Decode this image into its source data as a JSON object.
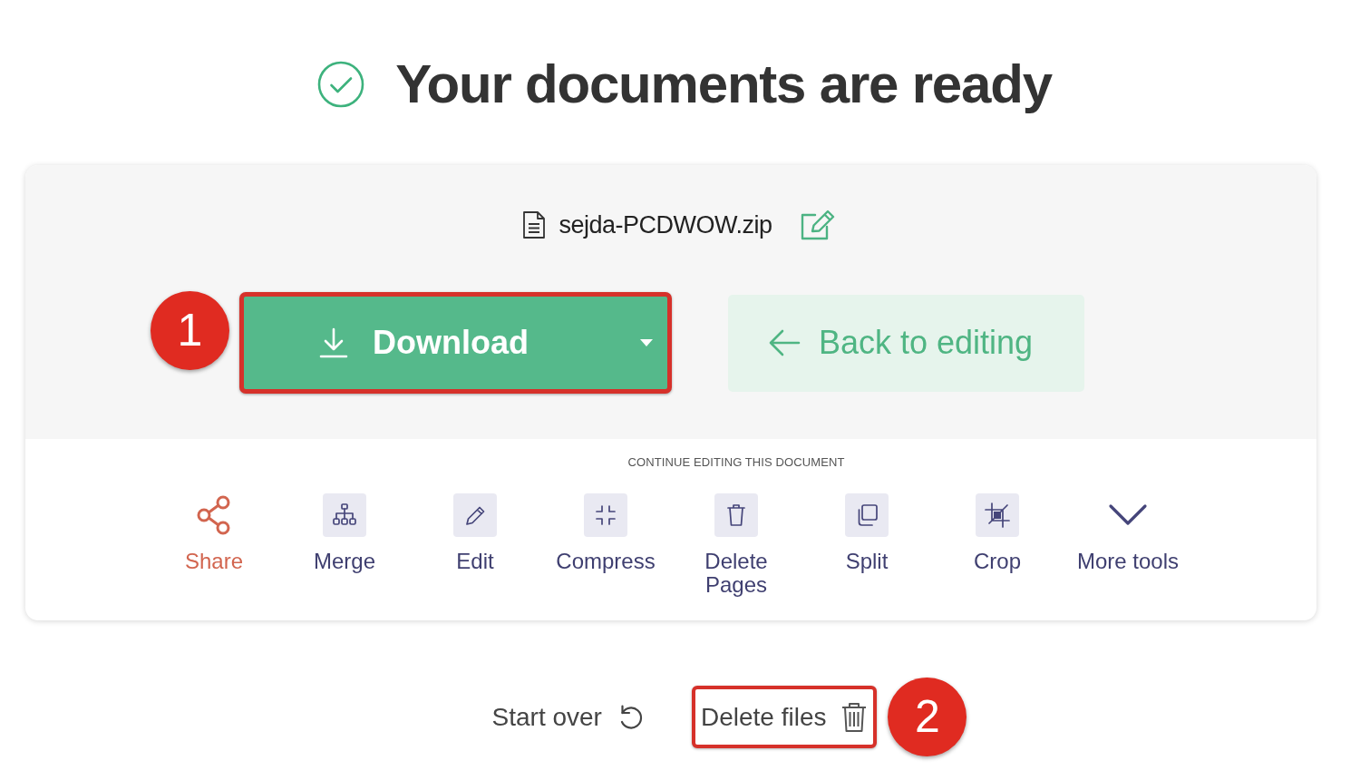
{
  "heading": {
    "title": "Your documents are ready"
  },
  "result_card": {
    "file_name": "sejda-PCDWOW.zip",
    "download_button": {
      "label": "Download",
      "highlighted": true,
      "callout": "1"
    },
    "back_button": {
      "label": "Back to editing",
      "highlighted": false
    },
    "tools_caption": "CONTINUE EDITING THIS DOCUMENT",
    "tools": [
      {
        "label": "Share",
        "kind": "share"
      },
      {
        "label": "Merge",
        "kind": "merge"
      },
      {
        "label": "Edit",
        "kind": "edit"
      },
      {
        "label": "Compress",
        "kind": "compress"
      },
      {
        "label": "Delete Pages",
        "kind": "delete_pages"
      },
      {
        "label": "Split",
        "kind": "split"
      },
      {
        "label": "Crop",
        "kind": "crop"
      },
      {
        "label": "More tools",
        "kind": "more"
      }
    ]
  },
  "footer_actions": [
    {
      "label": "Start over",
      "kind": "start_over",
      "highlighted": false
    },
    {
      "label": "Delete files",
      "kind": "delete_files",
      "highlighted": true,
      "callout": "2"
    }
  ]
}
